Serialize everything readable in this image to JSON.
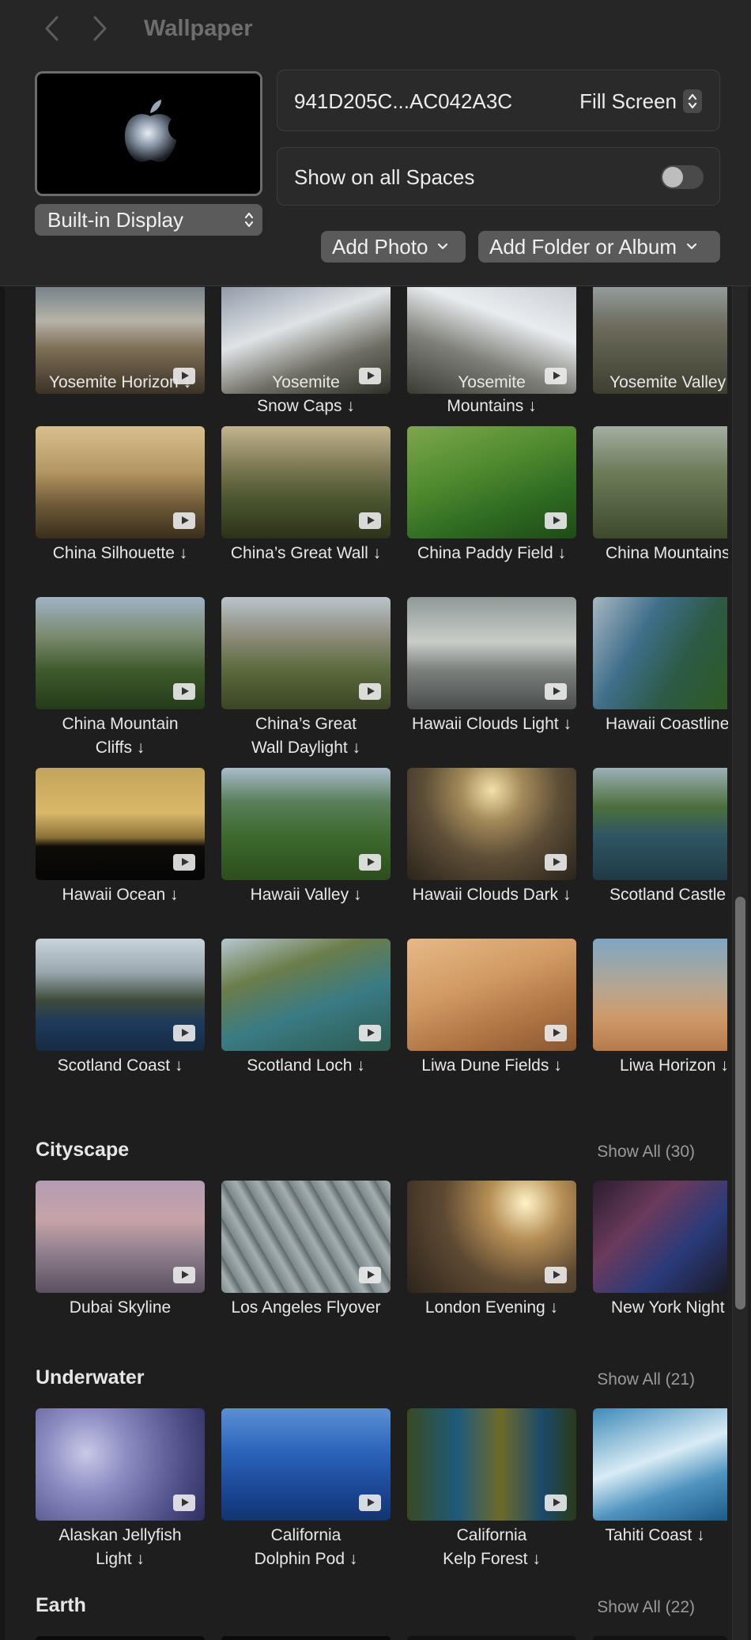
{
  "window": {
    "title": "Wallpaper"
  },
  "toolbar": {
    "back_icon": "chevron-left-icon",
    "forward_icon": "chevron-right-icon"
  },
  "current": {
    "wallpaper_id": "941D205C...AC042A3C",
    "fit_mode": "Fill Screen",
    "display": "Built-in Display",
    "show_on_all_spaces_label": "Show on all Spaces",
    "show_on_all_spaces": false
  },
  "actions": {
    "add_photo": "Add Photo",
    "add_folder": "Add Folder or Album"
  },
  "landscape_rows": [
    [
      {
        "line1": "Yosemite Horizon ↓",
        "line2": ""
      },
      {
        "line1": "Yosemite",
        "line2": "Snow Caps ↓"
      },
      {
        "line1": "Yosemite",
        "line2": "Mountains ↓"
      },
      {
        "line1": "Yosemite Valley",
        "line2": ""
      }
    ],
    [
      {
        "line1": "China Silhouette ↓",
        "line2": ""
      },
      {
        "line1": "China’s Great Wall ↓",
        "line2": ""
      },
      {
        "line1": "China Paddy Field ↓",
        "line2": ""
      },
      {
        "line1": "China Mountains",
        "line2": ""
      }
    ],
    [
      {
        "line1": "China Mountain",
        "line2": "Cliffs ↓"
      },
      {
        "line1": "China’s Great",
        "line2": "Wall Daylight ↓"
      },
      {
        "line1": "Hawaii Clouds Light ↓",
        "line2": ""
      },
      {
        "line1": "Hawaii Coastline",
        "line2": ""
      }
    ],
    [
      {
        "line1": "Hawaii Ocean ↓",
        "line2": ""
      },
      {
        "line1": "Hawaii Valley ↓",
        "line2": ""
      },
      {
        "line1": "Hawaii Clouds Dark ↓",
        "line2": ""
      },
      {
        "line1": "Scotland Castle",
        "line2": ""
      }
    ],
    [
      {
        "line1": "Scotland Coast ↓",
        "line2": ""
      },
      {
        "line1": "Scotland Loch ↓",
        "line2": ""
      },
      {
        "line1": "Liwa Dune Fields ↓",
        "line2": ""
      },
      {
        "line1": "Liwa Horizon ↓",
        "line2": ""
      }
    ]
  ],
  "sections": {
    "cityscape": {
      "title": "Cityscape",
      "show_all": "Show All (30)",
      "items": [
        {
          "line1": "Dubai Skyline",
          "line2": ""
        },
        {
          "line1": "Los Angeles Flyover",
          "line2": ""
        },
        {
          "line1": "London Evening ↓",
          "line2": ""
        },
        {
          "line1": "New York Night",
          "line2": ""
        }
      ]
    },
    "underwater": {
      "title": "Underwater",
      "show_all": "Show All (21)",
      "items": [
        {
          "line1": "Alaskan Jellyfish",
          "line2": "Light ↓"
        },
        {
          "line1": "California",
          "line2": "Dolphin Pod ↓"
        },
        {
          "line1": "California",
          "line2": "Kelp Forest ↓"
        },
        {
          "line1": "Tahiti Coast ↓",
          "line2": ""
        }
      ]
    },
    "earth": {
      "title": "Earth",
      "show_all": "Show All (22)"
    }
  },
  "colors": {
    "background": "#1e1e1e",
    "header": "#262626",
    "control": "#5a5a5a",
    "text": "#e8e8e8",
    "muted": "#9a9a9a"
  }
}
